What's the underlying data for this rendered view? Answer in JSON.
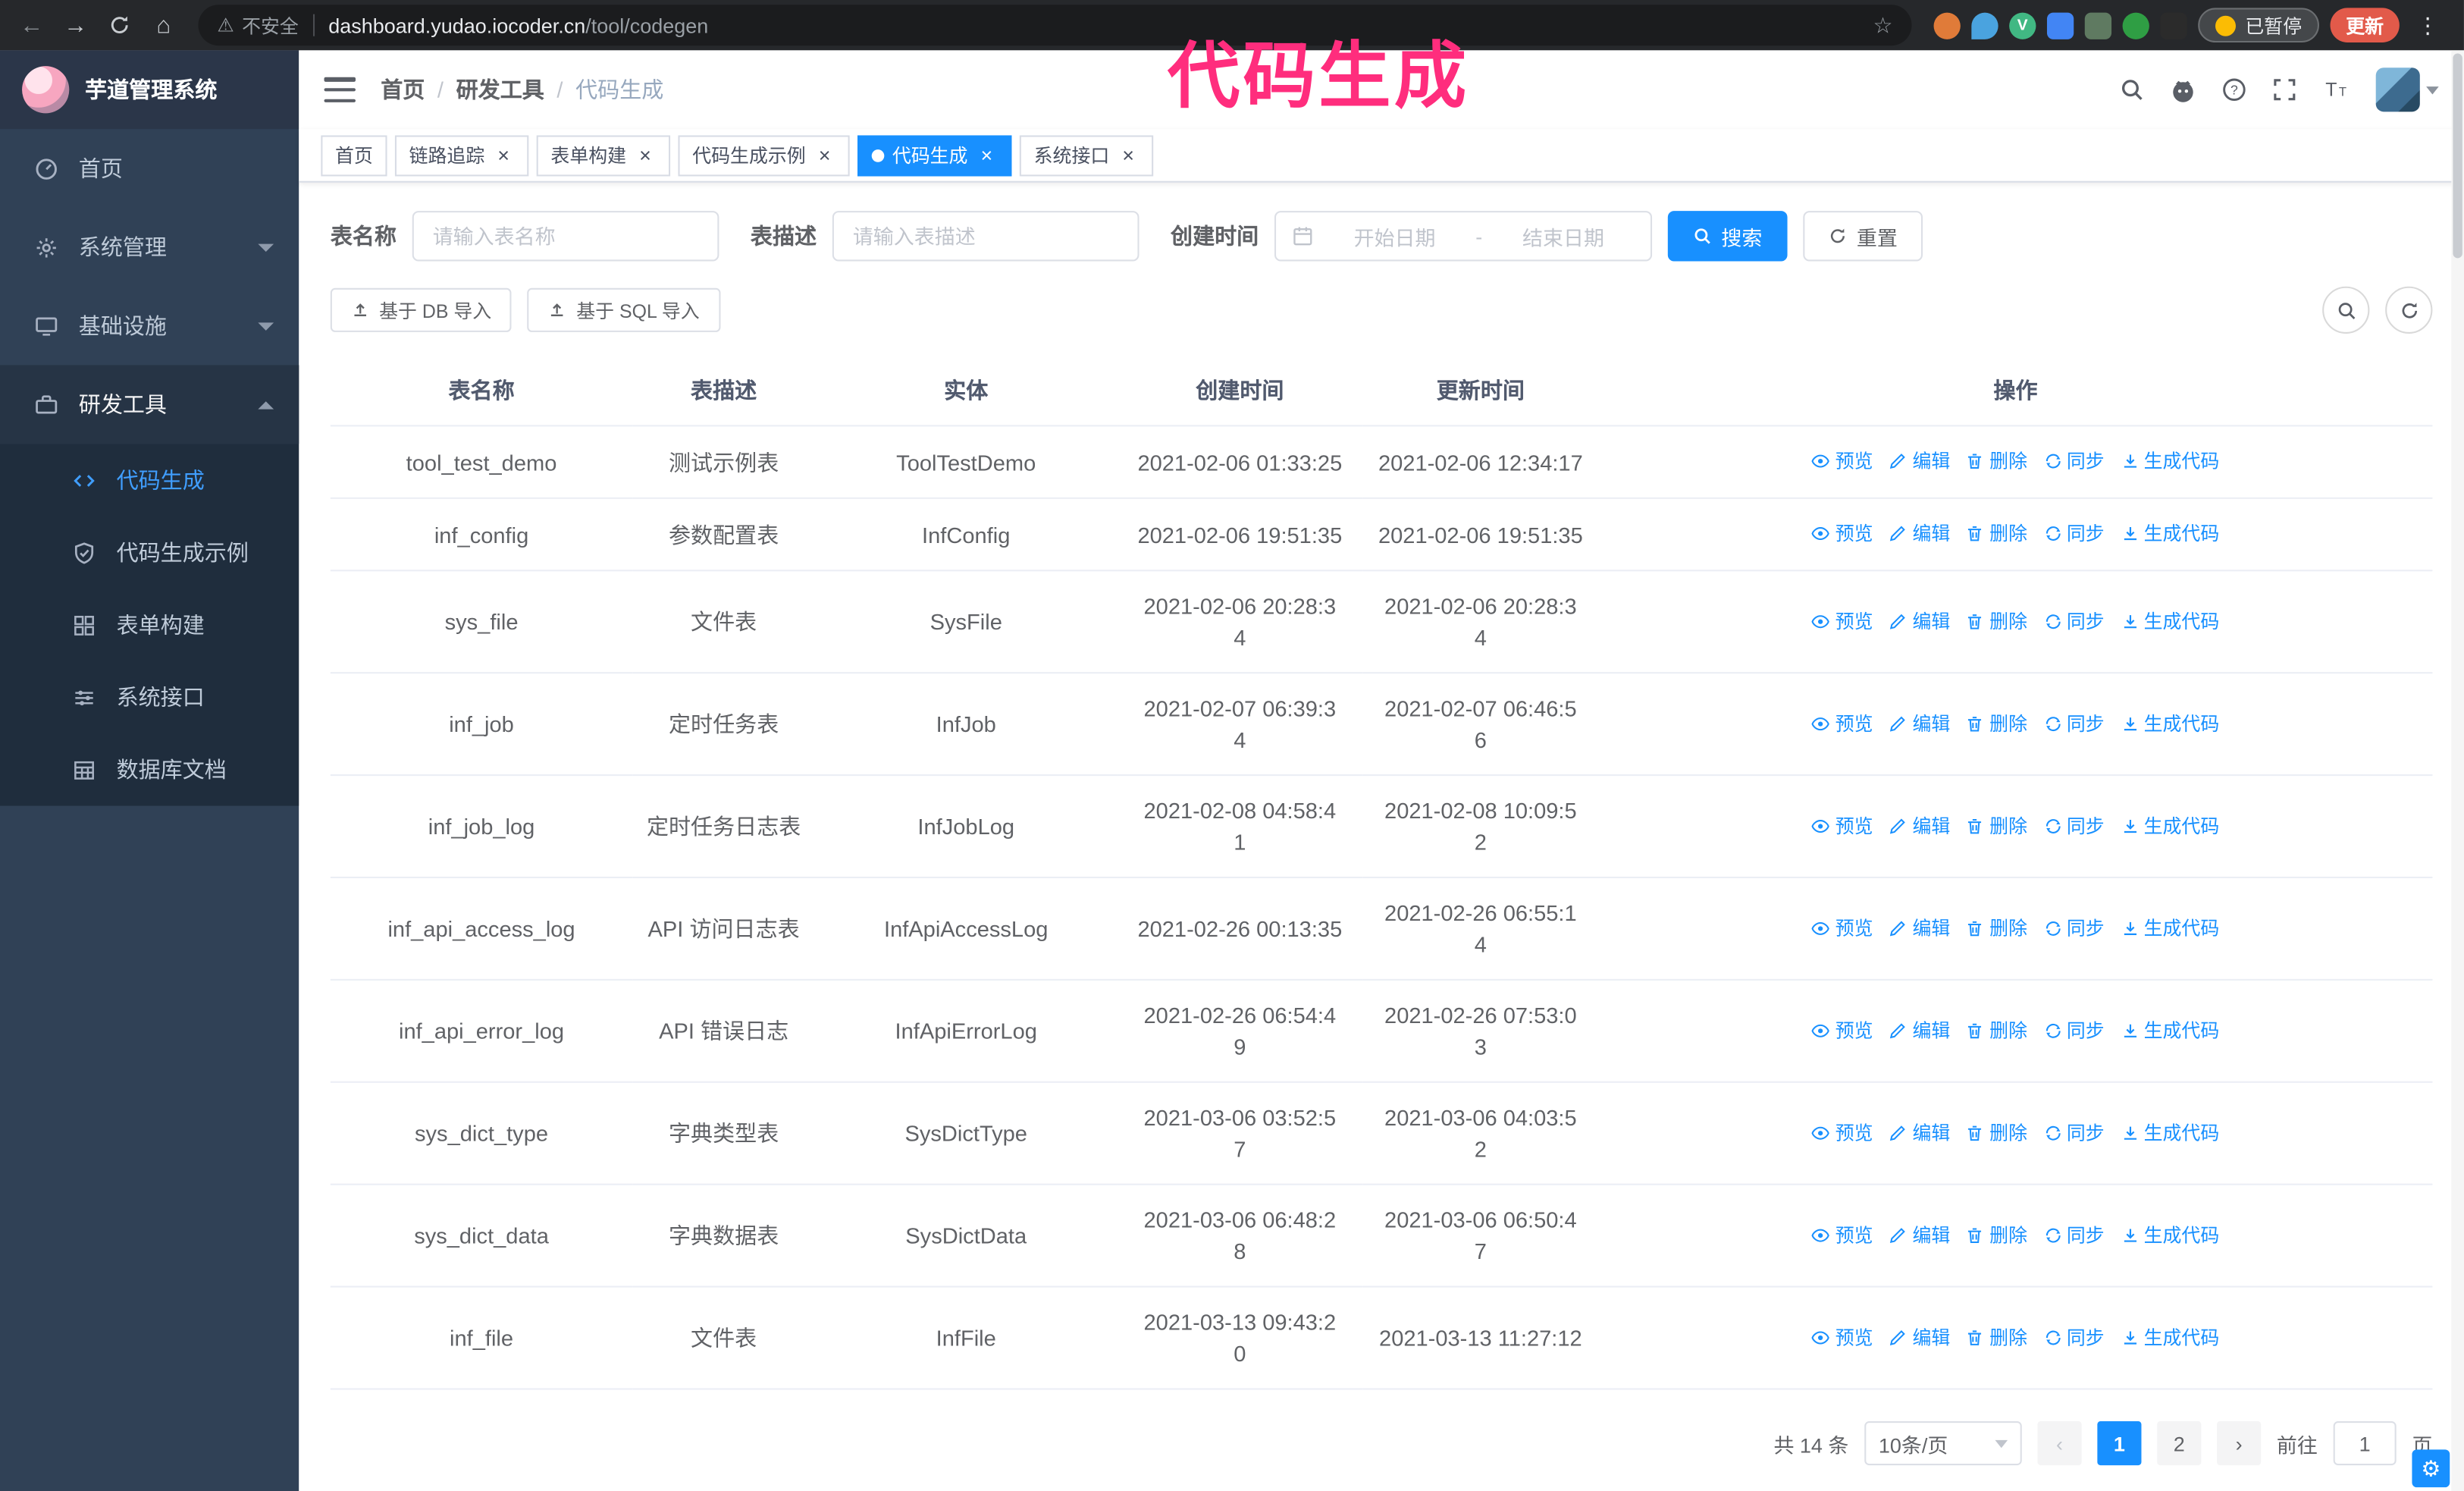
{
  "annotation": {
    "text": "代码生成"
  },
  "browser": {
    "security_label": "不安全",
    "url_host": "dashboard.yudao.iocoder.cn",
    "url_path": "/tool/codegen",
    "paused_badge": "已暂停",
    "update_button": "更新"
  },
  "sidebar": {
    "title": "芋道管理系统",
    "items": [
      {
        "label": "首页"
      },
      {
        "label": "系统管理"
      },
      {
        "label": "基础设施"
      },
      {
        "label": "研发工具"
      }
    ],
    "submenu": [
      {
        "label": "代码生成"
      },
      {
        "label": "代码生成示例"
      },
      {
        "label": "表单构建"
      },
      {
        "label": "系统接口"
      },
      {
        "label": "数据库文档"
      }
    ]
  },
  "breadcrumb": {
    "items": [
      "首页",
      "研发工具",
      "代码生成"
    ]
  },
  "tabs": [
    {
      "label": "首页"
    },
    {
      "label": "链路追踪"
    },
    {
      "label": "表单构建"
    },
    {
      "label": "代码生成示例"
    },
    {
      "label": "代码生成"
    },
    {
      "label": "系统接口"
    }
  ],
  "form": {
    "name_label": "表名称",
    "name_placeholder": "请输入表名称",
    "desc_label": "表描述",
    "desc_placeholder": "请输入表描述",
    "time_label": "创建时间",
    "start_placeholder": "开始日期",
    "range_separator": "-",
    "end_placeholder": "结束日期",
    "search_button": "搜索",
    "reset_button": "重置"
  },
  "toolbar": {
    "import_db_button": "基于 DB 导入",
    "import_sql_button": "基于 SQL 导入"
  },
  "table": {
    "columns": [
      "表名称",
      "表描述",
      "实体",
      "创建时间",
      "更新时间",
      "操作"
    ],
    "actions": [
      "预览",
      "编辑",
      "删除",
      "同步",
      "生成代码"
    ],
    "rows": [
      {
        "name": "tool_test_demo",
        "desc": "测试示例表",
        "entity": "ToolTestDemo",
        "create_time": "2021-02-06 01:33:25",
        "update_time": "2021-02-06 12:34:17"
      },
      {
        "name": "inf_config",
        "desc": "参数配置表",
        "entity": "InfConfig",
        "create_time": "2021-02-06 19:51:35",
        "update_time": "2021-02-06 19:51:35"
      },
      {
        "name": "sys_file",
        "desc": "文件表",
        "entity": "SysFile",
        "create_time": "2021-02-06 20:28:3\n4",
        "update_time": "2021-02-06 20:28:3\n4"
      },
      {
        "name": "inf_job",
        "desc": "定时任务表",
        "entity": "InfJob",
        "create_time": "2021-02-07 06:39:3\n4",
        "update_time": "2021-02-07 06:46:5\n6"
      },
      {
        "name": "inf_job_log",
        "desc": "定时任务日志表",
        "entity": "InfJobLog",
        "create_time": "2021-02-08 04:58:4\n1",
        "update_time": "2021-02-08 10:09:5\n2"
      },
      {
        "name": "inf_api_access_log",
        "desc": "API 访问日志表",
        "entity": "InfApiAccessLog",
        "create_time": "2021-02-26 00:13:35",
        "update_time": "2021-02-26 06:55:1\n4"
      },
      {
        "name": "inf_api_error_log",
        "desc": "API 错误日志",
        "entity": "InfApiErrorLog",
        "create_time": "2021-02-26 06:54:4\n9",
        "update_time": "2021-02-26 07:53:0\n3"
      },
      {
        "name": "sys_dict_type",
        "desc": "字典类型表",
        "entity": "SysDictType",
        "create_time": "2021-03-06 03:52:5\n7",
        "update_time": "2021-03-06 04:03:5\n2"
      },
      {
        "name": "sys_dict_data",
        "desc": "字典数据表",
        "entity": "SysDictData",
        "create_time": "2021-03-06 06:48:2\n8",
        "update_time": "2021-03-06 06:50:4\n7"
      },
      {
        "name": "inf_file",
        "desc": "文件表",
        "entity": "InfFile",
        "create_time": "2021-03-13 09:43:2\n0",
        "update_time": "2021-03-13 11:27:12"
      }
    ]
  },
  "pagination": {
    "total": "共 14 条",
    "page_size": "10条/页",
    "pages": [
      "1",
      "2"
    ],
    "goto_label": "前往",
    "goto_value": "1",
    "goto_suffix": "页"
  },
  "colors": {
    "primary": "#1890ff",
    "sidebar_bg": "#304156",
    "submenu_bg": "#1f2d3d",
    "annotation": "#ff2d7d"
  }
}
